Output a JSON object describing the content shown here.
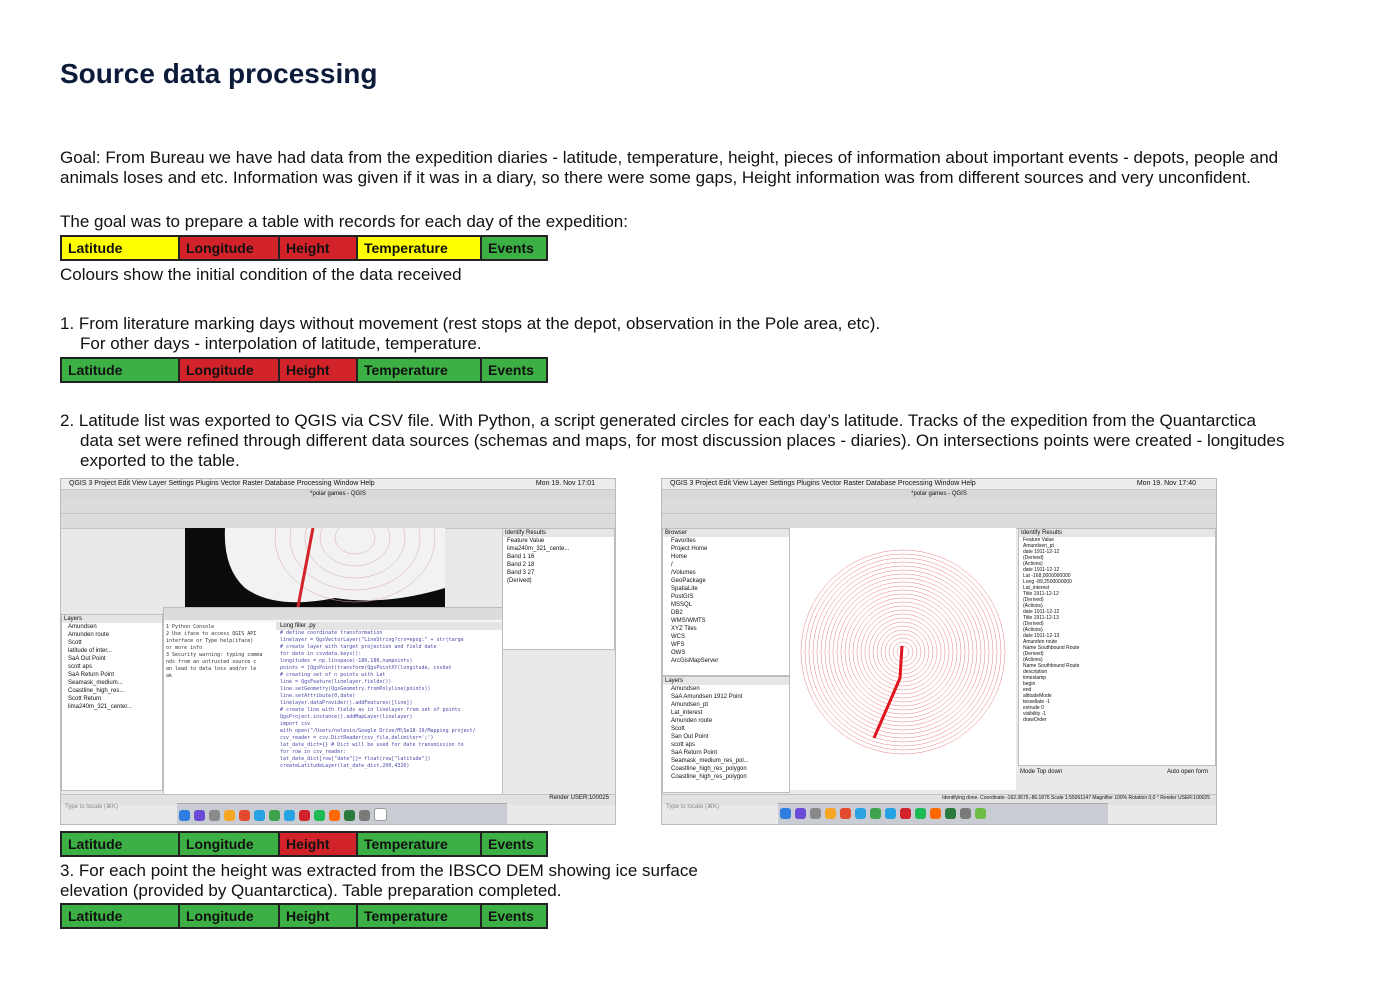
{
  "page": {
    "title": "Source data processing",
    "goal_text": "Goal: From Bureau we have had data from the expedition diaries - latitude, temperature, height, pieces of information about important events - depots, people and animals loses and etc. Information was given if it was in a diary, so there were some gaps, Height information was from different sources and very unconfident.",
    "goal_table_intro": "The goal was to prepare a table with records for each day of the expedition:",
    "colours_note": "Colours show the initial condition of the data received",
    "step1_line1": "1. From literature marking days without movement (rest stops at the depot, observation in the Pole area, etc).",
    "step1_line2": "For other days - interpolation of latitude, temperature.",
    "step2_text": "2. Latitude list was exported to QGIS via CSV file. With Python, a script generated circles for each day’s latitude. Tracks of the expedition from the Quantarctica data set were refined through different data sources (schemas and maps, for most discussion places - diaries). On intersections points were created - longitudes exported to the table.",
    "step3_text": "3. For each point the height was extracted from the IBSCO DEM showing ice surface elevation (provided by Quantarctica). Table preparation completed."
  },
  "colors": {
    "yellow": "#ffff00",
    "red": "#d2232a",
    "green": "#3cb044"
  },
  "tables": [
    {
      "cells": [
        {
          "label": "Latitude",
          "status": "yellow"
        },
        {
          "label": "Longitude",
          "status": "red"
        },
        {
          "label": "Height",
          "status": "red"
        },
        {
          "label": "Temperature",
          "status": "yellow"
        },
        {
          "label": "Events",
          "status": "green"
        }
      ]
    },
    {
      "cells": [
        {
          "label": "Latitude",
          "status": "green"
        },
        {
          "label": "Longitude",
          "status": "red"
        },
        {
          "label": "Height",
          "status": "red"
        },
        {
          "label": "Temperature",
          "status": "green"
        },
        {
          "label": "Events",
          "status": "green"
        }
      ]
    },
    {
      "cells": [
        {
          "label": "Latitude",
          "status": "green"
        },
        {
          "label": "Longitude",
          "status": "green"
        },
        {
          "label": "Height",
          "status": "red"
        },
        {
          "label": "Temperature",
          "status": "green"
        },
        {
          "label": "Events",
          "status": "green"
        }
      ]
    },
    {
      "cells": [
        {
          "label": "Latitude",
          "status": "green"
        },
        {
          "label": "Longitude",
          "status": "green"
        },
        {
          "label": "Height",
          "status": "green"
        },
        {
          "label": "Temperature",
          "status": "green"
        },
        {
          "label": "Events",
          "status": "green"
        }
      ]
    }
  ],
  "screenshot_left": {
    "menubar": "QGIS 3   Project   Edit   View   Layer   Settings   Plugins   Vector   Raster   Database   Processing   Window   Help",
    "clock": "Mon 19. Nov 17:01",
    "window_title": "*polar games - QGIS",
    "identify_title": "Identify Results",
    "identify_rows": [
      "Feature   Value",
      "lima240m_321_cente...",
      "Band 1   16",
      "Band 2   18",
      "Band 3   27",
      "(Derived)"
    ],
    "layers_title": "Layers",
    "layers": [
      "Amundsen",
      "Amunden route",
      "Scott",
      "latitude of inter...",
      "SaA Out Point",
      "scott aps",
      "SaA Return Point",
      "Seamask_medium...",
      "Coastline_high_res...",
      "Scott Return",
      "lima240m_321_center..."
    ],
    "console_title": "Python Console",
    "console_lines": [
      "1 Python Console",
      "2 Use iface to access QGIS API",
      "interface or Type help(iface)",
      "or more info",
      "3 Security warning: typing comma",
      "nds from an untrusted source c",
      "an lead to data loss and/or le",
      "ak"
    ],
    "editor_tab": "Long filler .py",
    "code_lines": [
      "# define coordinate transformation",
      "linelayer = QgsVectorLayer(\"LineString?crs=epsg:\" + str(targe",
      "# create layer with target projection and field date",
      "for date in csvdata.keys():",
      "longitudes = np.linspace(-180,180,numpoints)",
      "points = [QgsPoint(transform(QgsPointXY(longitude, csvdat",
      "# creating set of n points with Lat",
      "line = QgsFeature(linelayer.fields())",
      "line.setGeometry(QgsGeometry.fromPolyline(points))",
      "line.setAttribute(0,date)",
      "linelayer.dataProvider().addFeatures([line])",
      "# create line with fields as in linelayer from set of points",
      "QgsProject.instance().addMapLayer(linelayer)",
      "import csv",
      "with open(\"/Users/nolevin/Google Drive/M\\Se18-19/Mapping project/",
      "csv_reader = csv.DictReader(csv_file,delimiter=';')",
      "lat_date_dict={} # Dict will be used for date transmission to",
      "for row in csv_reader:",
      "lat_date_dict[row[\"date\"]]= float(row[\"latitude\"])",
      "createLatitudeLayer(lat_date_dict,200,4326)"
    ],
    "locate_placeholder": "Type to locate (⌘K)",
    "status": "Render   USER:100025"
  },
  "screenshot_right": {
    "menubar": "QGIS 3   Project   Edit   View   Layer   Settings   Plugins   Vector   Raster   Database   Processing   Window   Help",
    "clock": "Mon 19. Nov 17:40",
    "window_title": "*polar games - QGIS",
    "browser_title": "Browser",
    "browser_items": [
      "Favorites",
      "Project Home",
      "Home",
      "/",
      "/Volumes",
      "GeoPackage",
      "SpatiaLite",
      "PostGIS",
      "MSSQL",
      "DB2",
      "WMS/WMTS",
      "XYZ Tiles",
      "WCS",
      "WFS",
      "OWS",
      "ArcGisMapServer"
    ],
    "layers_title": "Layers",
    "layers": [
      "Amundsen",
      "SaA Amundsen 1912 Point",
      "Amundsen_pt",
      "Lat_interest",
      "Amunden route",
      "Scott",
      "San Out Point",
      "scott aps",
      "SaA Return Point",
      "Seamask_medium_res_pol...",
      "Coastline_high_res_polygon",
      "Coastline_high_res_polygon"
    ],
    "identify_title": "Identify Results",
    "identify_rows": [
      "Feature   Value",
      "Amundsen_pt",
      "date   1911-12-12",
      "(Derived)",
      "(Actions)",
      "date   1911-12-12",
      "Lat   -168,0000000000",
      "Long   -89,2500000000",
      "Lat_interest",
      "Title   1911-12-12",
      "(Derived)",
      "(Actions)",
      "date   1911-12-12",
      "Title   1911-12-13",
      "(Derived)",
      "(Actions)",
      "date   1911-12-13",
      "Amunden route",
      "Name   Southbound Route",
      "(Derived)",
      "(Actions)",
      "Name   Southbound Route",
      "description",
      "timestamp",
      "begin",
      "end",
      "altitudeMode",
      "tessellate   -1",
      "extrude   0",
      "visibility   -1",
      "drawOrder"
    ],
    "mode_label": "Mode   Top down",
    "auto_open": "Auto open form",
    "locate_placeholder": "Type to locate (⌘K)",
    "status": "Identifying done.   Coordinate   -162.3675,-86.1876   Scale   1:55061147   Magnifier 100%   Rotation 0,0 °   Render   USER:100025"
  }
}
